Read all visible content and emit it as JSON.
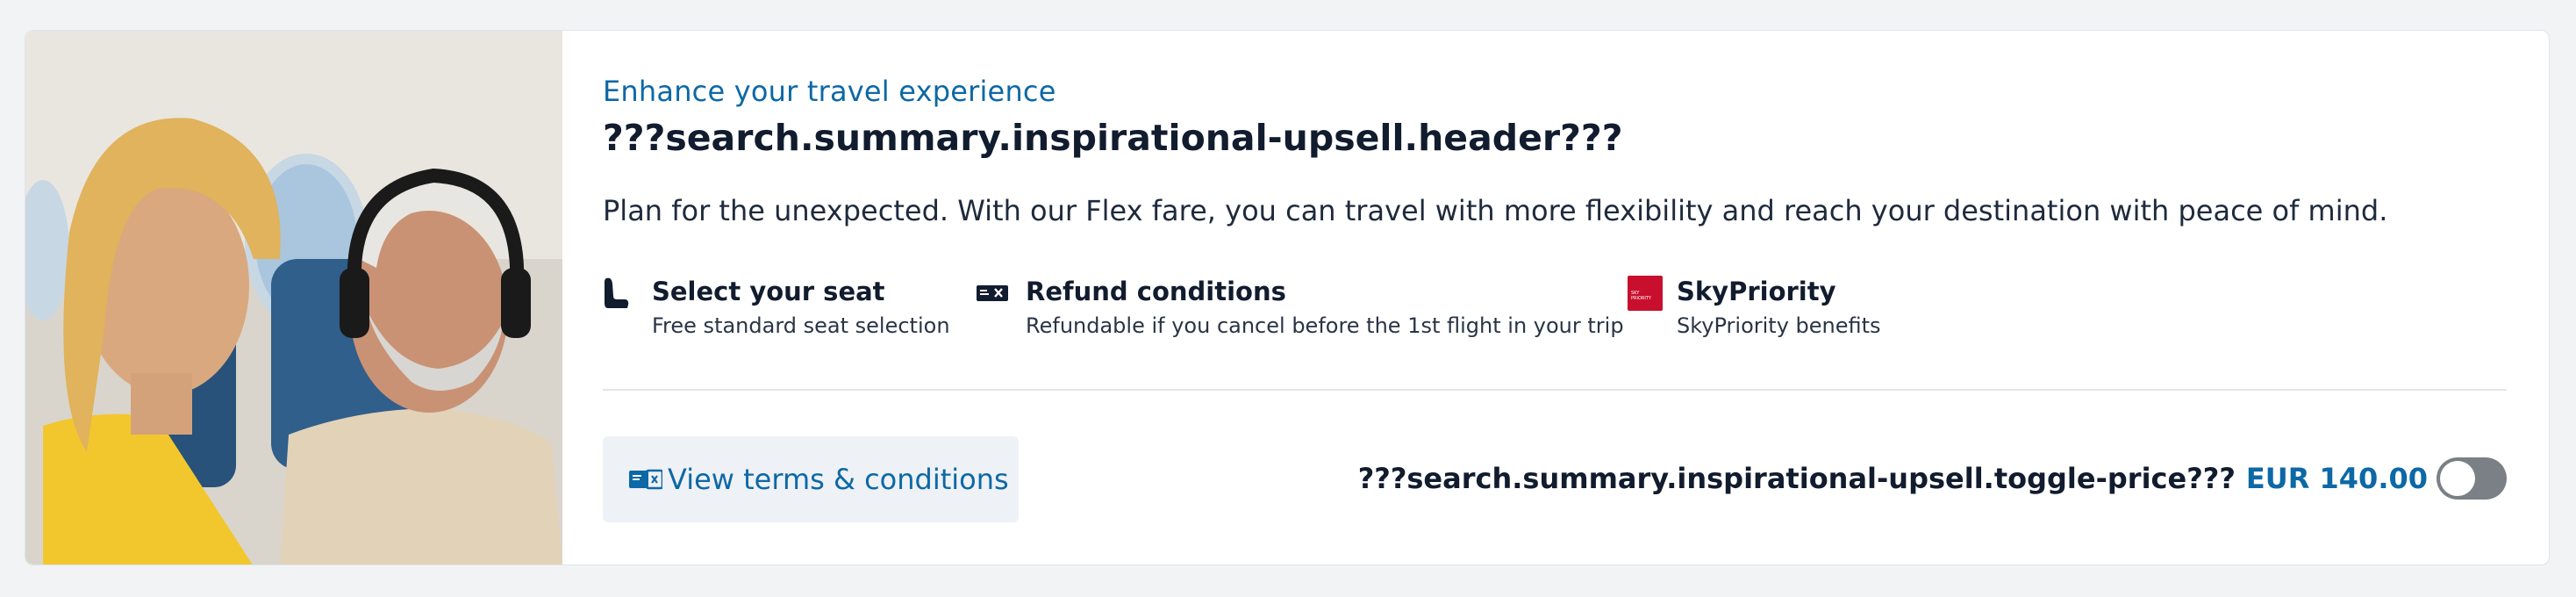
{
  "upsell": {
    "kicker": "Enhance your travel experience",
    "title": "???search.summary.inspirational-upsell.header???",
    "description": "Plan for the unexpected. With our Flex fare, you can travel with more flexibility and reach your destination with peace of mind.",
    "benefits": [
      {
        "icon": "seat-icon",
        "title": "Select your seat",
        "subtitle": "Free standard seat selection"
      },
      {
        "icon": "ticket-cancel-icon",
        "title": "Refund conditions",
        "subtitle": "Refundable if you cancel before the 1st flight in your trip"
      },
      {
        "icon": "skypriority-logo",
        "title": "SkyPriority",
        "subtitle": "SkyPriority benefits",
        "logo_text": "SKY PRIORITY"
      }
    ],
    "terms_button": {
      "icon": "terms-ticket-icon",
      "label": "View terms & conditions"
    },
    "toggle": {
      "label": "???search.summary.inspirational-upsell.toggle-price???",
      "price": "EUR 140.00",
      "checked": false
    }
  },
  "colors": {
    "accent": "#0c68a6",
    "text_primary": "#111c2e",
    "skypriority_red": "#c8102e",
    "toggle_off": "#7b7f86"
  }
}
